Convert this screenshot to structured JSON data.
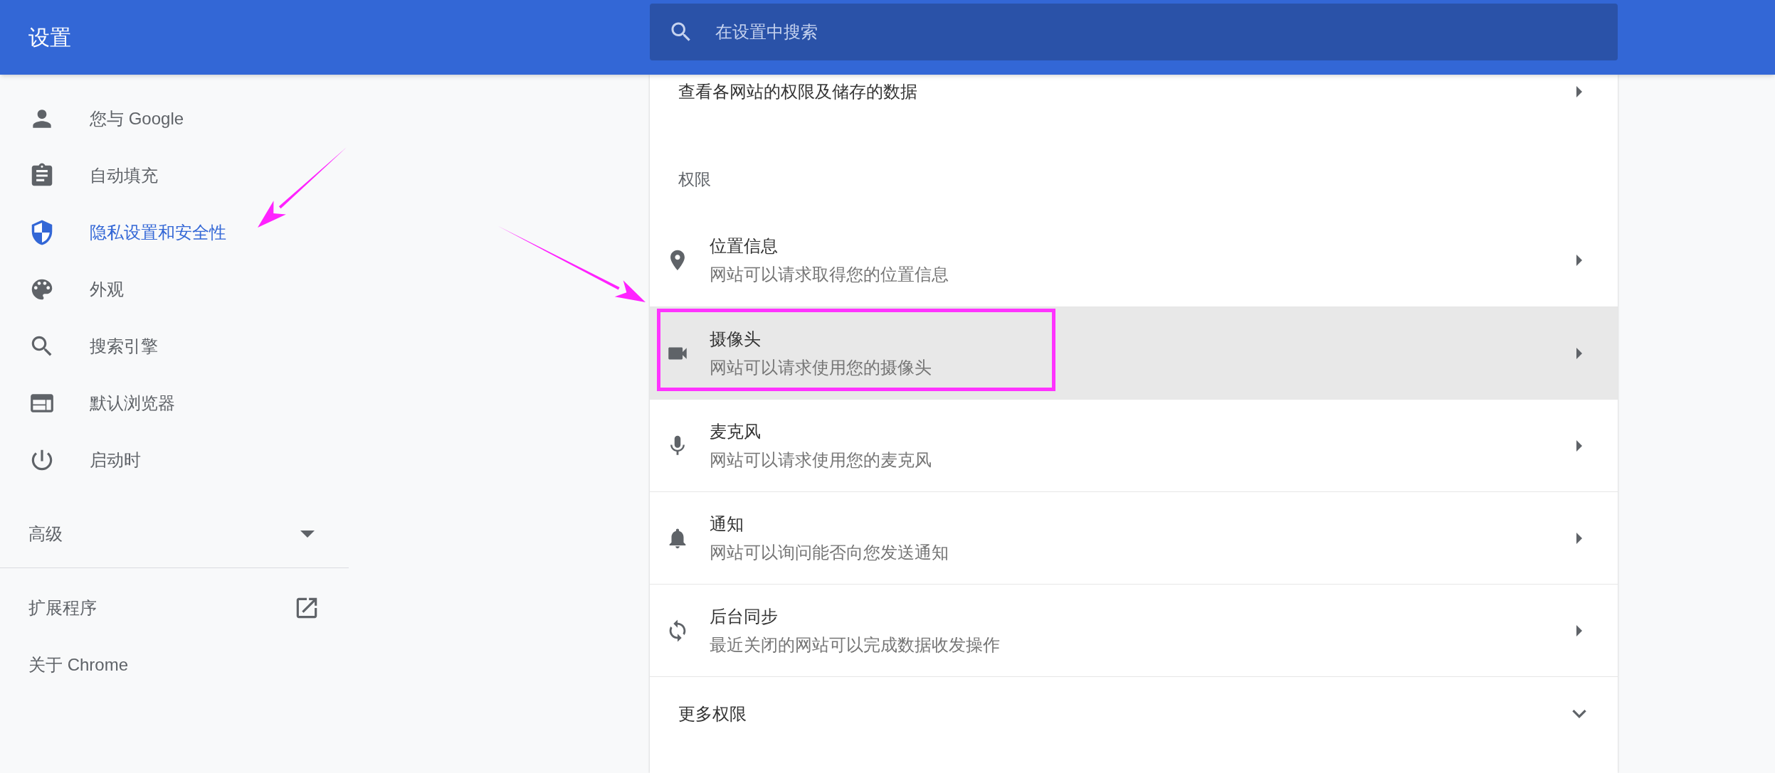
{
  "header": {
    "title": "设置",
    "search": {
      "placeholder": "在设置中搜索"
    }
  },
  "sidebar": {
    "items": [
      {
        "label": "您与 Google",
        "selected": false
      },
      {
        "label": "自动填充",
        "selected": false
      },
      {
        "label": "隐私设置和安全性",
        "selected": true
      },
      {
        "label": "外观",
        "selected": false
      },
      {
        "label": "搜索引擎",
        "selected": false
      },
      {
        "label": "默认浏览器",
        "selected": false
      },
      {
        "label": "启动时",
        "selected": false
      }
    ],
    "advanced": {
      "label": "高级",
      "expanded": false
    },
    "extensions": {
      "label": "扩展程序"
    },
    "about": {
      "label": "关于 Chrome"
    }
  },
  "main": {
    "site_data_row": {
      "label": "查看各网站的权限及储存的数据"
    },
    "section_title": "权限",
    "permissions": [
      {
        "title": "位置信息",
        "subtitle": "网站可以请求取得您的位置信息",
        "selected": false,
        "outlined": false
      },
      {
        "title": "摄像头",
        "subtitle": "网站可以请求使用您的摄像头",
        "selected": true,
        "outlined": true
      },
      {
        "title": "麦克风",
        "subtitle": "网站可以请求使用您的麦克风",
        "selected": false,
        "outlined": false
      },
      {
        "title": "通知",
        "subtitle": "网站可以询问能否向您发送通知",
        "selected": false,
        "outlined": false
      },
      {
        "title": "后台同步",
        "subtitle": "最近关闭的网站可以完成数据收发操作",
        "selected": false,
        "outlined": false
      }
    ],
    "more_row": {
      "label": "更多权限",
      "expanded": false
    }
  },
  "annotations": [
    {
      "kind": "arrow"
    },
    {
      "kind": "arrow"
    }
  ]
}
